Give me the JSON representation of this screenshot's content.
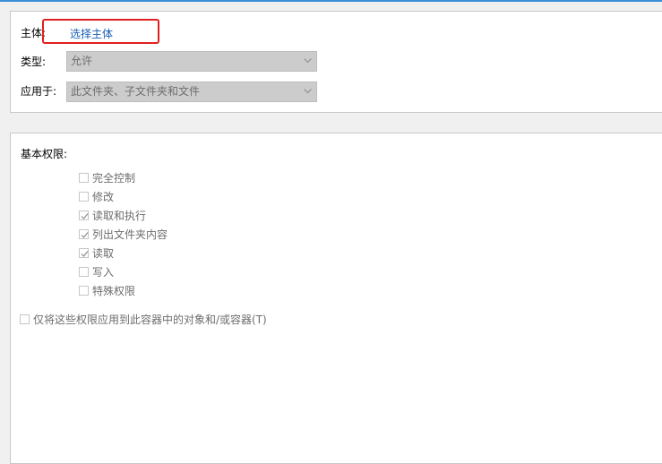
{
  "principal": {
    "label": "主体:",
    "link": "选择主体"
  },
  "type": {
    "label": "类型:",
    "value": "允许"
  },
  "applies_to": {
    "label": "应用于:",
    "value": "此文件夹、子文件夹和文件"
  },
  "basic_permissions": {
    "label": "基本权限:",
    "items": [
      {
        "label": "完全控制",
        "checked": false
      },
      {
        "label": "修改",
        "checked": false
      },
      {
        "label": "读取和执行",
        "checked": true
      },
      {
        "label": "列出文件夹内容",
        "checked": true
      },
      {
        "label": "读取",
        "checked": true
      },
      {
        "label": "写入",
        "checked": false
      },
      {
        "label": "特殊权限",
        "checked": false
      }
    ]
  },
  "apply_only": {
    "label": "仅将这些权限应用到此容器中的对象和/或容器(T)",
    "checked": false
  },
  "colors": {
    "link": "#1a5fb4",
    "highlight": "#e02020",
    "disabled_text": "#6d6d6d",
    "accent_edge": "#3b8fd6"
  },
  "icons": {
    "combo_arrow": "chevron-down-icon",
    "checkmark": "check-icon"
  }
}
